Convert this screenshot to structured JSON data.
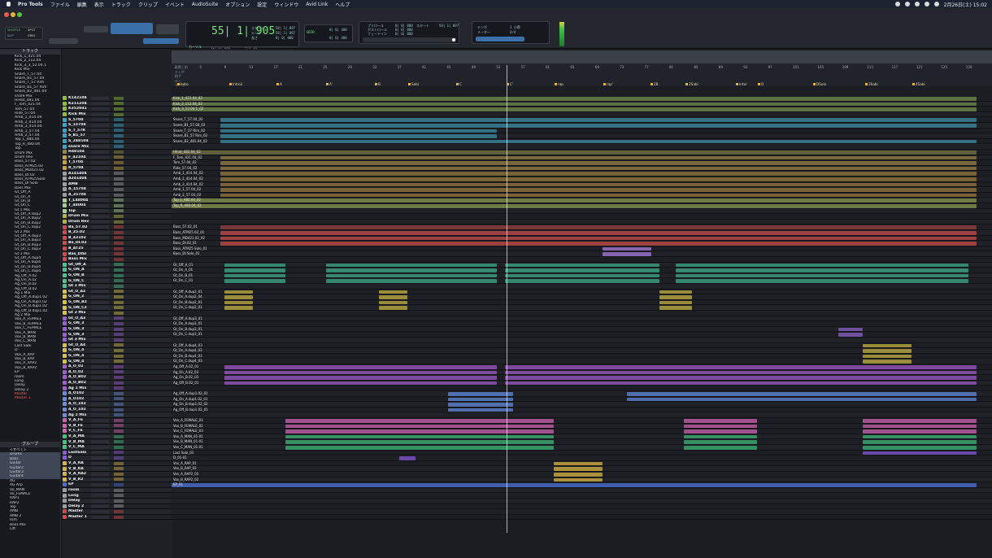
{
  "menubar": {
    "apple": "",
    "app": "Pro Tools",
    "items": [
      "ファイル",
      "編集",
      "表示",
      "トラック",
      "クリップ",
      "イベント",
      "AudioSuite",
      "オプション",
      "設定",
      "ウィンドウ",
      "Avid Link",
      "ヘルプ"
    ],
    "datetime": "2月26日(土) 15:02"
  },
  "toolbar": {
    "mode_shuffle": "SHUFFLE",
    "mode_spot": "SPOT",
    "mode_slip": "SLIP",
    "mode_grid": "GRID",
    "counter": "55| 1| 905",
    "counter_label": "カーソル",
    "counter_extra": "14| 0| 669",
    "gain": "+7.5 dB",
    "start_label": "スタート",
    "end_label": "エンド",
    "length_label": "長さ",
    "start_val": "58| 1| 097",
    "end_val": "58| 1| 097",
    "length_val": "0| 0| 000",
    "pre_label": "プリロール",
    "post_label": "ポストロール",
    "fade_label": "フェードイン",
    "pre_val": "0| 0| 000",
    "post_val": "0| 0| 000",
    "fade_val": "0| 0| 000",
    "grid_val": "0| 0| 480",
    "nudge_val": "0| 0| 480",
    "tempo_label": "テンポ",
    "meter_label": "メーター",
    "tempo_val": "1 小節",
    "meter_val": "4/4"
  },
  "panels": {
    "tracks_title": "トラック",
    "groups_title": "グループ"
  },
  "ruler": {
    "labels": [
      "小節 | 拍",
      "テンポ",
      "拍子",
      "キー",
      "マーカー"
    ],
    "bars": [
      "1",
      "5",
      "9",
      "13",
      "17",
      "21",
      "25",
      "29",
      "33",
      "37",
      "41",
      "45",
      "49",
      "53",
      "57",
      "61",
      "65",
      "69",
      "73",
      "77",
      "81",
      "85",
      "89",
      "93",
      "97",
      "101",
      "105",
      "109",
      "113",
      "117",
      "121",
      "125",
      "129"
    ],
    "meter": "4/4",
    "key": "Em",
    "marker_header": "マーカー"
  },
  "markers": [
    "Intro",
    "Intro2",
    "A",
    "A'",
    "B",
    "Sabi",
    "C",
    "C'",
    "rap",
    "rap'",
    "2B",
    "2Sabi",
    "Inter",
    "D",
    "DSolo",
    "3Sabi",
    "4Sabi"
  ],
  "tracks_list": [
    "Kick_1_421.04",
    "Kick_2_112.04",
    "Kick_3_3_52.04.1",
    "Kick Mix",
    "Snare_T_57.04",
    "Snare_B1_57.04",
    "Snare_T_57 Rim",
    "Snare_B1_57 Rim",
    "Snare_B2_481.04",
    "snare Mix",
    "HiHat_481.04",
    "F_Tom_421.04",
    "Tom_57.04",
    "Ride_57.04",
    "Amb_1_414.04",
    "Amb_2_414.04",
    "Amb_3_414.04",
    "Amb_1_57.04",
    "Amb_2_57.04",
    "Top_L_480.04",
    "Top_R_480.04",
    "Top",
    "Drum Mix",
    "Drum Rev",
    "Bass_57.02",
    "Bass_ATM25.02",
    "Bass_MD421.02",
    "Bass_DI.02",
    "Bass_ATM25Solo",
    "Bass_DI Solo",
    "Bass Mix",
    "Gt_Off_A",
    "Gt_On_A",
    "Gt_On_B",
    "Gt_On_C",
    "Gt 1 Mix",
    "Gt_Off_A.dup2",
    "Gt_On_A.dup2",
    "Gt_On_B.dup2",
    "Gt_On_C.dup2",
    "Gt 2 Mix",
    "Gt_Off_A.dup3",
    "Gt_On_A.dup3",
    "Gt_On_B.dup3",
    "Gt_On_C.dup3",
    "Gt 3 Mix",
    "Gt_Off_A.dup4",
    "Gt_On_A.dup4",
    "Gt_On_B.dup4",
    "Gt_On_C.dup4",
    "Ag_Off_A.02",
    "Ag_On_A.02",
    "Ag_On_B.02",
    "Ag_Off_B.02",
    "Ag 1 Mix",
    "Ag_Off_A.dup1.02",
    "Ag_On_A.dup1.02",
    "Ag_On_B.dup1.02",
    "Ag_Off_B.dup1.02",
    "Ag 2 Mix",
    "Vox_A_FEMALE",
    "Vox_B_FEMALE",
    "Vox_C_FEMALE",
    "Vox_A_MAN",
    "Vox_B_MAN",
    "Vox_C_MAN",
    "Last Sabi",
    "D",
    "Vox_A_RAP",
    "Vox_B_RAP",
    "Vox_A_RAP2",
    "Vox_B_RAP2",
    "EP",
    "room",
    "Long",
    "Delay",
    "Delay 2",
    "Master",
    "Master 1"
  ],
  "groups": [
    "<すべて>",
    "Drums",
    "Bass",
    "Guitar",
    "Guitar2",
    "Guitar3",
    "Guitar4",
    "AG",
    "AG Arp",
    "Vo_MAN",
    "Vo_FEMALE",
    "RAP1",
    "RAP2",
    "Top",
    "AMB",
    "AMB 2",
    "Rim",
    "Bass Mix",
    "Lift"
  ],
  "name_rows": [
    [
      "K142104",
      "#8fbf3a"
    ],
    [
      "K211204",
      "#8fbf3a"
    ],
    [
      "K352041",
      "#8fbf3a"
    ],
    [
      "Kick Mix",
      "#8fbf3a"
    ],
    [
      "S_5704",
      "#3aa7c9"
    ],
    [
      "S_15704",
      "#3aa7c9"
    ],
    [
      "S_T_57R",
      "#3aa7c9"
    ],
    [
      "S_B1_57",
      "#3aa7c9"
    ],
    [
      "S_248104",
      "#3aa7c9"
    ],
    [
      "snare Mix",
      "#3aa7c9"
    ],
    [
      "H48104",
      "#8e8e3e"
    ],
    [
      "F_42104",
      "#c9a43a"
    ],
    [
      "T_5704",
      "#c9a43a"
    ],
    [
      "R_5704",
      "#c9a43a"
    ],
    [
      "A141404",
      "#9e9e9e"
    ],
    [
      "A241404",
      "#9e9e9e"
    ],
    [
      "AMB",
      "#9e9e9e"
    ],
    [
      "A_15704",
      "#9e9e9e"
    ],
    [
      "A_25704",
      "#9e9e9e"
    ],
    [
      "T_L48004",
      "#a8d18f"
    ],
    [
      "T_48004",
      "#a8d18f"
    ],
    [
      "Top",
      "#a8d18f"
    ],
    [
      "Drum Mix",
      "#b5b542"
    ],
    [
      "Drum Rev",
      "#b5b542"
    ],
    [
      "Ba_57.02",
      "#d14a4a"
    ],
    [
      "B_25.02",
      "#d14a4a"
    ],
    [
      "B_42102",
      "#d14a4a"
    ],
    [
      "Ba_DI.02",
      "#d14a4a"
    ],
    [
      "B_AT25",
      "#d14a4a"
    ],
    [
      "Bas_DISl",
      "#d14a4a"
    ],
    [
      "Bass Mix",
      "#d14a4a"
    ],
    [
      "Gt_Off_A",
      "#4cc38a"
    ],
    [
      "G_ON_A",
      "#4cc38a"
    ],
    [
      "G_ON_B",
      "#4cc38a"
    ],
    [
      "G_ON_C",
      "#4cc38a"
    ],
    [
      "Gt 1 Mix",
      "#4cc38a"
    ],
    [
      "Gt_O_A2",
      "#d9c24a"
    ],
    [
      "G_ON_2",
      "#d9c24a"
    ],
    [
      "G_ON_B2",
      "#d9c24a"
    ],
    [
      "G_ON_C2",
      "#d9c24a"
    ],
    [
      "Gt 2 Mix",
      "#d9c24a"
    ],
    [
      "Gt_O_A3",
      "#9a5fd1"
    ],
    [
      "G_ON_3",
      "#9a5fd1"
    ],
    [
      "G_ON_3",
      "#9a5fd1"
    ],
    [
      "G_ON_3",
      "#9a5fd1"
    ],
    [
      "Gt 3 Mix",
      "#9a5fd1"
    ],
    [
      "Gt_O_A4",
      "#d9c24a"
    ],
    [
      "G_ON_4",
      "#d9c24a"
    ],
    [
      "G_ON_4",
      "#d9c24a"
    ],
    [
      "G_ON_4",
      "#d9c24a"
    ],
    [
      "A_O_02",
      "#a15ccd"
    ],
    [
      "A_O_02",
      "#a15ccd"
    ],
    [
      "A_O_B02",
      "#a15ccd"
    ],
    [
      "A_O_B02",
      "#a15ccd"
    ],
    [
      "Ag 1 Mix",
      "#a15ccd"
    ],
    [
      "A_O102",
      "#6d8fd9"
    ],
    [
      "A_O102",
      "#6d8fd9"
    ],
    [
      "A_O_102",
      "#6d8fd9"
    ],
    [
      "A_O_102",
      "#6d8fd9"
    ],
    [
      "Ag 2 Mix",
      "#6d8fd9"
    ],
    [
      "V_A_FE",
      "#d264b3"
    ],
    [
      "V_B_FE",
      "#d264b3"
    ],
    [
      "V_C_FE",
      "#d264b3"
    ],
    [
      "V_A_MA",
      "#45c47f"
    ],
    [
      "V_B_MA",
      "#45c47f"
    ],
    [
      "V_C_MA",
      "#45c47f"
    ],
    [
      "LastSabi",
      "#8b5ad6"
    ],
    [
      "D",
      "#8b5ad6"
    ],
    [
      "V_A_RA",
      "#d9b24a"
    ],
    [
      "V_B_RA",
      "#d9b24a"
    ],
    [
      "V_A_RA2",
      "#d9b24a"
    ],
    [
      "V_B_R2",
      "#d9b24a"
    ],
    [
      "EP",
      "#4a6fd9"
    ],
    [
      "room",
      "#9e9e9e"
    ],
    [
      "Long",
      "#9e9e9e"
    ],
    [
      "Delay",
      "#9e9e9e"
    ],
    [
      "Delay 2",
      "#9e9e9e"
    ],
    [
      "Master",
      "#d14a4a"
    ],
    [
      "Master 1",
      "#d14a4a"
    ]
  ],
  "lanes": [
    [
      "Kick_1_421.04_02",
      "#6a7f4a"
    ],
    [
      "Kick_2_112.04_02",
      "#6a7f4a"
    ],
    [
      "Kick_3_52.04.1_02",
      "#6a7f4a"
    ],
    [
      "",
      "#000"
    ],
    [
      "Snare_T_57.04_02",
      "#3a7f95"
    ],
    [
      "Snare_B1_57.04_02",
      "#3a7f95"
    ],
    [
      "Snare_T_57 Rim_02",
      "#3a7f95"
    ],
    [
      "Snare_B1_57 Rim_02",
      "#3a7f95"
    ],
    [
      "Snare_B2_481.04_02",
      "#3a7f95"
    ],
    [
      "",
      "#000"
    ],
    [
      "Hihat_481.04_02",
      "#6d6d45"
    ],
    [
      "F_Tom_421.04_02",
      "#8a7442"
    ],
    [
      "Tom_57.04_02",
      "#8a7442"
    ],
    [
      "Ride_57.04_02",
      "#8a7442"
    ],
    [
      "Amb_1_414.04_02",
      "#8a6d3a"
    ],
    [
      "Amb_2_414.04_02",
      "#8a6d3a"
    ],
    [
      "Amb_3_414.04_02",
      "#8a6d3a"
    ],
    [
      "Amb_1_57.04_02",
      "#8a6d3a"
    ],
    [
      "Amb_2_57.04_02",
      "#8a6d3a"
    ],
    [
      "Top_L_480.04_02",
      "#7a8b4a"
    ],
    [
      "Top_R_480.04_02",
      "#7a8b4a"
    ],
    [
      "",
      "#000"
    ],
    [
      "",
      "#000"
    ],
    [
      "",
      "#000"
    ],
    [
      "Bass_57.02_01",
      "#8a3e3e"
    ],
    [
      "Bass_ATM25.02_01",
      "#b54545"
    ],
    [
      "Bass_MD421.02_02",
      "#b54545"
    ],
    [
      "Bass_DI.02_01",
      "#b54545"
    ],
    [
      "Bass_ATM25 Solo_01",
      "#9a70c9"
    ],
    [
      "Bass_DI Solo_01",
      "#9a70c9"
    ],
    [
      "",
      "#000"
    ],
    [
      "Gt_Off_A_01",
      "#3a9a7a"
    ],
    [
      "Gt_On_A_01",
      "#3a9a7a"
    ],
    [
      "Gt_On_B_01",
      "#3a9a7a"
    ],
    [
      "Gt_On_C_01",
      "#3a9a7a"
    ],
    [
      "",
      "#000"
    ],
    [
      "Gt_Off_A.dup2_01",
      "#b0a040"
    ],
    [
      "Gt_On_A.dup2_04",
      "#b0a040"
    ],
    [
      "Gt_On_B.dup2_01",
      "#b0a040"
    ],
    [
      "Gt_On_C.dup2_01",
      "#b0a040"
    ],
    [
      "",
      "#000"
    ],
    [
      "Gt_Off_A.dup3_01",
      "#7e5bb5"
    ],
    [
      "Gt_On_A.dup3_01",
      "#7e5bb5"
    ],
    [
      "Gt_On_B.dup3_01",
      "#7e5bb5"
    ],
    [
      "Gt_On_C.dup3_01",
      "#7e5bb5"
    ],
    [
      "",
      "#000"
    ],
    [
      "Gt_Off_A.dup4_03",
      "#b0a040"
    ],
    [
      "Gt_On_A.dup4_03",
      "#b0a040"
    ],
    [
      "Gt_On_B.dup4_03",
      "#b0a040"
    ],
    [
      "Gt_On_C.dup4_03",
      "#b0a040"
    ],
    [
      "Ag_Off_A.02_01",
      "#8e52b5"
    ],
    [
      "Ag_On_A.02_03",
      "#8e52b5"
    ],
    [
      "Ag_On_B.02_03",
      "#8e52b5"
    ],
    [
      "Ag_Off_B.02_01",
      "#8e52b5"
    ],
    [
      "",
      "#000"
    ],
    [
      "Ag_Off_A.dup1.02_01",
      "#5b7cc4"
    ],
    [
      "Ag_On_A.dup1.02_01",
      "#5b7cc4"
    ],
    [
      "Ag_On_B.dup1.02_02",
      "#5b7cc4"
    ],
    [
      "Ag_Off_B.dup1.02_01",
      "#5b7cc4"
    ],
    [
      "",
      "#000"
    ],
    [
      "Vox_A_FEMALE_03",
      "#b85aa0"
    ],
    [
      "Vox_B_FEMALE_02",
      "#b85aa0"
    ],
    [
      "Vox_C_FEMALE_03",
      "#b85aa0"
    ],
    [
      "Vox_A_MAN_01-01",
      "#3aa36e"
    ],
    [
      "Vox_B_MAN_01-01",
      "#3aa36e"
    ],
    [
      "Vox_C_MAN_01-01",
      "#3aa36e"
    ],
    [
      "Last Sabi_01",
      "#7a50c0"
    ],
    [
      "D_01-01",
      "#7a50c0"
    ],
    [
      "Vox_A_RAP_01",
      "#c4a43e"
    ],
    [
      "Vox_B_RAP_02",
      "#c4a43e"
    ],
    [
      "Vox_A_RAP2_02",
      "#c4a43e"
    ],
    [
      "Vox_B_RAP2_02",
      "#c4a43e"
    ],
    [
      "EP_01",
      "#4a6ac4"
    ],
    [
      "",
      "#000"
    ],
    [
      "",
      "#000"
    ],
    [
      "",
      "#000"
    ],
    [
      "",
      "#000"
    ],
    [
      "",
      "#000"
    ],
    [
      "",
      "#000"
    ]
  ],
  "lane_clips": [
    [
      [
        0,
        990
      ]
    ],
    [
      [
        0,
        990
      ]
    ],
    [
      [
        0,
        990
      ]
    ],
    [],
    [
      [
        60,
        990
      ]
    ],
    [
      [
        60,
        990
      ]
    ],
    [
      [
        60,
        400
      ]
    ],
    [
      [
        60,
        400
      ]
    ],
    [
      [
        60,
        990
      ]
    ],
    [],
    [
      [
        0,
        990
      ]
    ],
    [
      [
        60,
        990
      ]
    ],
    [
      [
        60,
        990
      ]
    ],
    [
      [
        60,
        990
      ]
    ],
    [
      [
        60,
        990
      ]
    ],
    [
      [
        60,
        990
      ]
    ],
    [
      [
        60,
        990
      ]
    ],
    [
      [
        60,
        990
      ]
    ],
    [
      [
        60,
        990
      ]
    ],
    [
      [
        0,
        990
      ]
    ],
    [
      [
        0,
        990
      ]
    ],
    [],
    [],
    [],
    [
      [
        60,
        990
      ]
    ],
    [
      [
        60,
        990
      ]
    ],
    [
      [
        60,
        990
      ]
    ],
    [
      [
        60,
        990
      ]
    ],
    [
      [
        530,
        590
      ]
    ],
    [
      [
        530,
        590
      ]
    ],
    [],
    [
      [
        65,
        140
      ],
      [
        190,
        400
      ],
      [
        410,
        600
      ],
      [
        620,
        980
      ]
    ],
    [
      [
        65,
        140
      ],
      [
        190,
        400
      ],
      [
        410,
        600
      ],
      [
        620,
        980
      ]
    ],
    [
      [
        65,
        140
      ],
      [
        190,
        400
      ],
      [
        410,
        600
      ],
      [
        620,
        980
      ]
    ],
    [
      [
        65,
        140
      ],
      [
        190,
        400
      ],
      [
        410,
        600
      ],
      [
        620,
        980
      ]
    ],
    [],
    [
      [
        65,
        100
      ],
      [
        255,
        290
      ],
      [
        600,
        640
      ]
    ],
    [
      [
        65,
        100
      ],
      [
        255,
        290
      ],
      [
        600,
        640
      ]
    ],
    [
      [
        65,
        100
      ],
      [
        255,
        290
      ],
      [
        600,
        640
      ]
    ],
    [
      [
        65,
        100
      ],
      [
        255,
        290
      ],
      [
        600,
        640
      ]
    ],
    [],
    [],
    [],
    [
      [
        820,
        850
      ]
    ],
    [
      [
        820,
        850
      ]
    ],
    [],
    [
      [
        850,
        910
      ]
    ],
    [
      [
        850,
        910
      ]
    ],
    [
      [
        850,
        910
      ]
    ],
    [
      [
        850,
        910
      ]
    ],
    [
      [
        65,
        400
      ],
      [
        410,
        990
      ]
    ],
    [
      [
        65,
        400
      ],
      [
        410,
        990
      ]
    ],
    [
      [
        65,
        400
      ],
      [
        410,
        990
      ]
    ],
    [
      [
        65,
        400
      ],
      [
        410,
        990
      ]
    ],
    [],
    [
      [
        340,
        420
      ],
      [
        560,
        990
      ]
    ],
    [
      [
        340,
        420
      ],
      [
        560,
        990
      ]
    ],
    [
      [
        340,
        420
      ]
    ],
    [
      [
        340,
        420
      ]
    ],
    [],
    [
      [
        140,
        470
      ],
      [
        630,
        720
      ],
      [
        850,
        990
      ]
    ],
    [
      [
        140,
        470
      ],
      [
        630,
        720
      ],
      [
        850,
        990
      ]
    ],
    [
      [
        140,
        470
      ],
      [
        630,
        720
      ],
      [
        850,
        990
      ]
    ],
    [
      [
        140,
        470
      ],
      [
        630,
        720
      ],
      [
        850,
        990
      ]
    ],
    [
      [
        140,
        470
      ],
      [
        630,
        720
      ],
      [
        850,
        990
      ]
    ],
    [
      [
        140,
        470
      ],
      [
        630,
        720
      ],
      [
        850,
        990
      ]
    ],
    [
      [
        850,
        990
      ]
    ],
    [
      [
        280,
        300
      ]
    ],
    [
      [
        470,
        530
      ]
    ],
    [
      [
        470,
        530
      ]
    ],
    [
      [
        470,
        530
      ]
    ],
    [
      [
        470,
        530
      ]
    ],
    [
      [
        0,
        990
      ]
    ],
    [],
    [],
    [],
    [],
    [],
    []
  ]
}
